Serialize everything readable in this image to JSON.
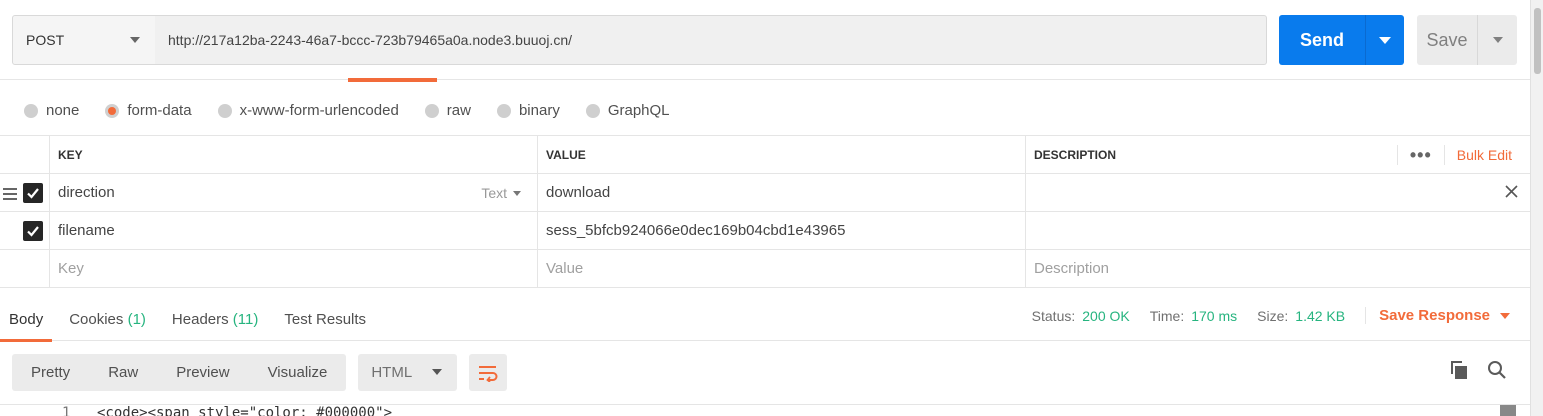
{
  "request": {
    "method": "POST",
    "url": "http://217a12ba-2243-46a7-bccc-723b79465a0a.node3.buuoj.cn/",
    "send_label": "Send",
    "save_label": "Save"
  },
  "body_types": [
    {
      "label": "none",
      "selected": false
    },
    {
      "label": "form-data",
      "selected": true
    },
    {
      "label": "x-www-form-urlencoded",
      "selected": false
    },
    {
      "label": "raw",
      "selected": false
    },
    {
      "label": "binary",
      "selected": false
    },
    {
      "label": "GraphQL",
      "selected": false
    }
  ],
  "params_table": {
    "headers": {
      "key": "KEY",
      "value": "VALUE",
      "description": "DESCRIPTION"
    },
    "bulk_edit": "Bulk Edit",
    "rows": [
      {
        "key": "direction",
        "type": "Text",
        "value": "download",
        "description": "",
        "checked": true
      },
      {
        "key": "filename",
        "value": "sess_5bfcb924066e0dec169b04cbd1e43965",
        "description": "",
        "checked": true
      }
    ],
    "placeholders": {
      "key": "Key",
      "value": "Value",
      "description": "Description"
    }
  },
  "response": {
    "tabs": [
      {
        "label": "Body",
        "count": ""
      },
      {
        "label": "Cookies",
        "count": "(1)"
      },
      {
        "label": "Headers",
        "count": "(11)"
      },
      {
        "label": "Test Results",
        "count": ""
      }
    ],
    "status_label": "Status:",
    "status_value": "200 OK",
    "time_label": "Time:",
    "time_value": "170 ms",
    "size_label": "Size:",
    "size_value": "1.42 KB",
    "save_response": "Save Response",
    "view_modes": [
      "Pretty",
      "Raw",
      "Preview",
      "Visualize"
    ],
    "format": "HTML",
    "first_line_number": "1",
    "first_line_code": "<code><span style=\"color: #000000\">"
  },
  "colors": {
    "accent": "#f26b3a",
    "primary": "#097bed",
    "success": "#26b47f"
  }
}
